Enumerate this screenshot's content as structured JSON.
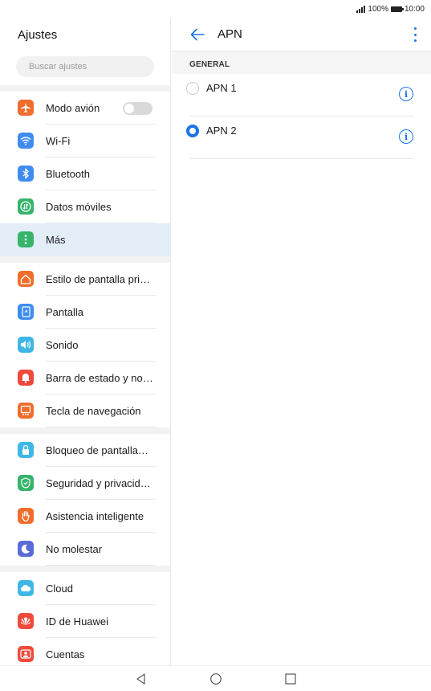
{
  "status_bar": {
    "battery": "100%",
    "time": "10:00"
  },
  "settings": {
    "title": "Ajustes",
    "search_placeholder": "Buscar ajustes",
    "items": [
      {
        "label": "Modo avión",
        "icon": "airplane-icon",
        "color": "#f06d2c"
      },
      {
        "label": "Wi-Fi",
        "icon": "wifi-icon",
        "color": "#3f8cf0"
      },
      {
        "label": "Bluetooth",
        "icon": "bluetooth-icon",
        "color": "#3f8cf0"
      },
      {
        "label": "Datos móviles",
        "icon": "mobile-data-icon",
        "color": "#35b46a"
      },
      {
        "label": "Más",
        "icon": "more-icon",
        "color": "#35b46a"
      },
      {
        "label": "Estilo de pantalla pri…",
        "icon": "home-screen-icon",
        "color": "#f06d2c"
      },
      {
        "label": "Pantalla",
        "icon": "display-icon",
        "color": "#3f8cf0"
      },
      {
        "label": "Sonido",
        "icon": "sound-icon",
        "color": "#3fb7e6"
      },
      {
        "label": "Barra de estado y no…",
        "icon": "notification-bell-icon",
        "color": "#ef4a3c"
      },
      {
        "label": "Tecla de navegación",
        "icon": "navigation-key-icon",
        "color": "#f06d2c"
      },
      {
        "label": "Bloqueo de pantalla…",
        "icon": "lock-icon",
        "color": "#3fb7e6"
      },
      {
        "label": "Seguridad y privacid…",
        "icon": "shield-icon",
        "color": "#35b46a"
      },
      {
        "label": "Asistencia inteligente",
        "icon": "hand-icon",
        "color": "#f06d2c"
      },
      {
        "label": "No molestar",
        "icon": "moon-icon",
        "color": "#5a6bd8"
      },
      {
        "label": "Cloud",
        "icon": "cloud-icon",
        "color": "#3fb7e6"
      },
      {
        "label": "ID de Huawei",
        "icon": "huawei-logo-icon",
        "color": "#ef4a3c"
      },
      {
        "label": "Cuentas",
        "icon": "account-icon",
        "color": "#ef4a3c"
      }
    ],
    "selected": "Más",
    "airplane_mode_on": false
  },
  "apn": {
    "title": "APN",
    "section": "GENERAL",
    "entries": [
      {
        "label": "APN 1",
        "selected": false
      },
      {
        "label": "APN 2",
        "selected": true
      }
    ],
    "accent": "#1a73e8"
  }
}
